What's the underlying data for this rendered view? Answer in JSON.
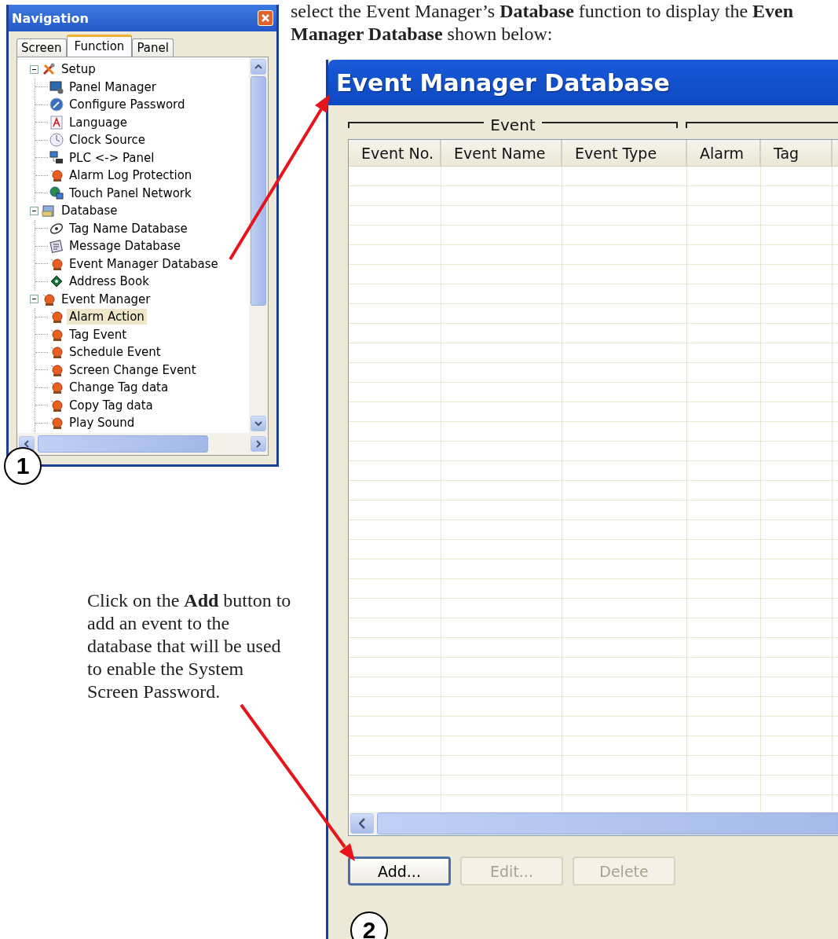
{
  "intro": {
    "lines": [
      "select the Event Manager’s **Database** function to display the **Even**",
      "**Manager Database** shown below:"
    ]
  },
  "navigation": {
    "title": "Navigation",
    "step": "1",
    "tabs": [
      {
        "label": "Screen",
        "selected": false
      },
      {
        "label": "Function",
        "selected": true
      },
      {
        "label": "Panel",
        "selected": false
      }
    ],
    "tree": [
      {
        "label": "Setup",
        "kind": "tools",
        "expanded": true,
        "selected": false,
        "children": [
          {
            "label": "Panel Manager",
            "kind": "monitor",
            "selected": false
          },
          {
            "label": "Configure Password",
            "kind": "disc",
            "selected": false
          },
          {
            "label": "Language",
            "kind": "letter",
            "selected": false
          },
          {
            "label": "Clock Source",
            "kind": "clock",
            "selected": false
          },
          {
            "label": "PLC <-> Panel",
            "kind": "computers",
            "selected": false
          },
          {
            "label": "Alarm Log Protection",
            "kind": "bell",
            "selected": false
          },
          {
            "label": "Touch Panel Network",
            "kind": "globe",
            "selected": false
          }
        ]
      },
      {
        "label": "Database",
        "kind": "folder",
        "expanded": true,
        "selected": false,
        "children": [
          {
            "label": "Tag Name Database",
            "kind": "tag",
            "selected": false
          },
          {
            "label": "Message Database",
            "kind": "notepad",
            "selected": false
          },
          {
            "label": "Event Manager Database",
            "kind": "bell",
            "selected": false
          },
          {
            "label": "Address Book",
            "kind": "book",
            "selected": false
          }
        ]
      },
      {
        "label": "Event Manager",
        "kind": "bell",
        "expanded": true,
        "selected": false,
        "children": [
          {
            "label": "Alarm Action",
            "kind": "bell",
            "selected": true
          },
          {
            "label": "Tag Event",
            "kind": "bell",
            "selected": false
          },
          {
            "label": "Schedule Event",
            "kind": "bell",
            "selected": false
          },
          {
            "label": "Screen Change Event",
            "kind": "bell",
            "selected": false
          },
          {
            "label": "Change Tag data",
            "kind": "bell",
            "selected": false
          },
          {
            "label": "Copy Tag data",
            "kind": "bell",
            "selected": false
          },
          {
            "label": "Play Sound",
            "kind": "bell",
            "selected": false
          }
        ]
      }
    ]
  },
  "instruction": "Click on the **Add** button to add an event to the database that will be used to enable the System Screen Password.",
  "event_window": {
    "title": "Event Manager Database",
    "step": "2",
    "group": "Event",
    "columns": [
      "Event No.",
      "Event Name",
      "Event Type",
      "Alarm",
      "Tag"
    ],
    "buttons": [
      {
        "label": "Add...",
        "default": true,
        "disabled": false
      },
      {
        "label": "Edit...",
        "default": false,
        "disabled": true
      },
      {
        "label": "Delete",
        "default": false,
        "disabled": true
      }
    ]
  }
}
